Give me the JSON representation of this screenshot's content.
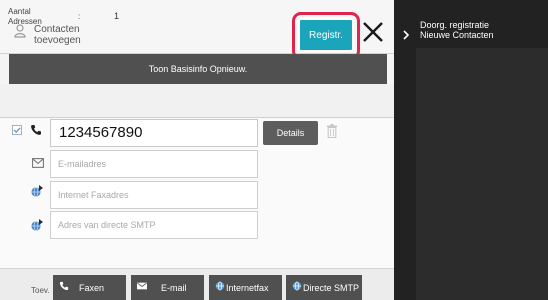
{
  "header": {
    "title_line1": "Contacten",
    "title_line2": "toevoegen",
    "register_label": "Registr."
  },
  "basis_bar": {
    "label": "Toon Basisinfo Opnieuw."
  },
  "address_count": {
    "label_line1": "Aantal",
    "label_line2": "Adressen",
    "separator": ":",
    "value": "1"
  },
  "fields": {
    "fax_value": "1234567890",
    "details_label": "Details",
    "email_placeholder": "E-mailadres",
    "ifax_placeholder": "Internet Faxadres",
    "smtp_placeholder": "Adres van directe SMTP"
  },
  "bottom_bar": {
    "add_label": "Toev.",
    "buttons": [
      {
        "label": "Faxen",
        "icon": "phone-icon"
      },
      {
        "label": "E-mail",
        "icon": "mail-icon"
      },
      {
        "label": "Internetfax",
        "icon": "globe-icon"
      },
      {
        "label": "Directe SMTP",
        "icon": "globe-icon"
      }
    ]
  },
  "side_panel": {
    "line1": "Doorg. registratie",
    "line2": "Nieuwe Contacten"
  },
  "colors": {
    "accent_teal": "#1aa5ba",
    "highlight_red": "#e0244c",
    "dark_button": "#505050"
  }
}
